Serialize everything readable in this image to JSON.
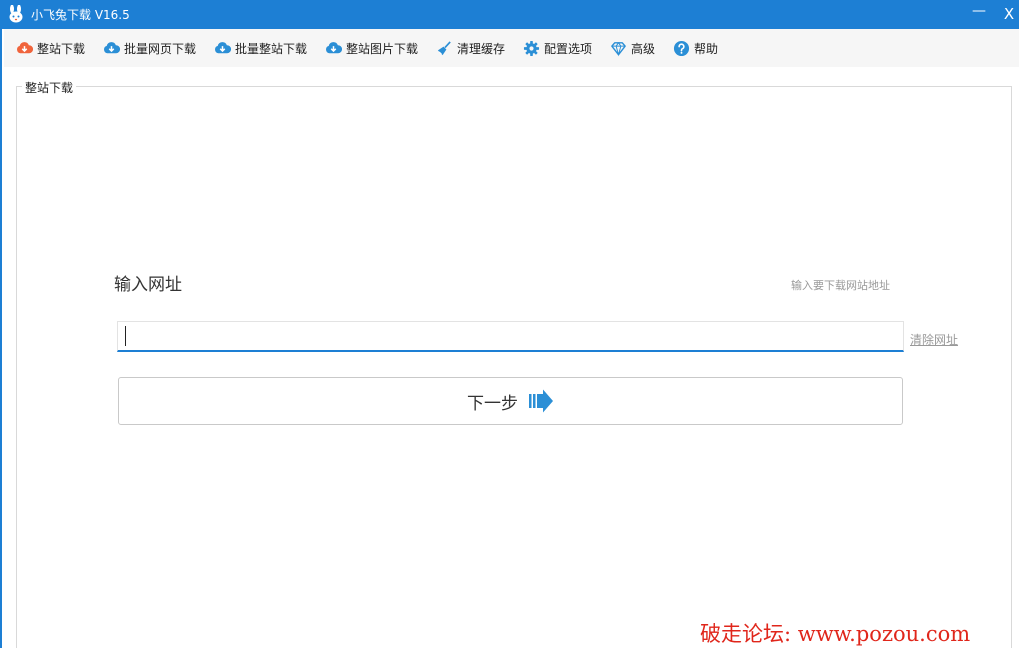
{
  "titlebar": {
    "title": "小飞兔下载 V16.5",
    "minimize": "—",
    "close": "X"
  },
  "toolbar": {
    "items": [
      {
        "label": "整站下载",
        "icon": "cloud-download-icon",
        "color": "#f0643c"
      },
      {
        "label": "批量网页下载",
        "icon": "cloud-download-icon",
        "color": "#2b8fd6"
      },
      {
        "label": "批量整站下载",
        "icon": "cloud-download-icon",
        "color": "#2b8fd6"
      },
      {
        "label": "整站图片下载",
        "icon": "cloud-download-icon",
        "color": "#2b8fd6"
      },
      {
        "label": "清理缓存",
        "icon": "broom-icon",
        "color": "#2b8fd6"
      },
      {
        "label": "配置选项",
        "icon": "gear-icon",
        "color": "#2b8fd6"
      },
      {
        "label": "高级",
        "icon": "diamond-icon",
        "color": "#2b8fd6"
      },
      {
        "label": "帮助",
        "icon": "help-icon",
        "color": "#2b8fd6"
      }
    ]
  },
  "main": {
    "group_label": "整站下载",
    "url_title": "输入网址",
    "url_hint": "输入要下载网站地址",
    "url_value": "",
    "clear_link": "清除网址",
    "next_button": "下一步"
  },
  "watermark": "破走论坛: www.pozou.com",
  "colors": {
    "accent": "#1d7fd4",
    "watermark": "#e0261b"
  }
}
